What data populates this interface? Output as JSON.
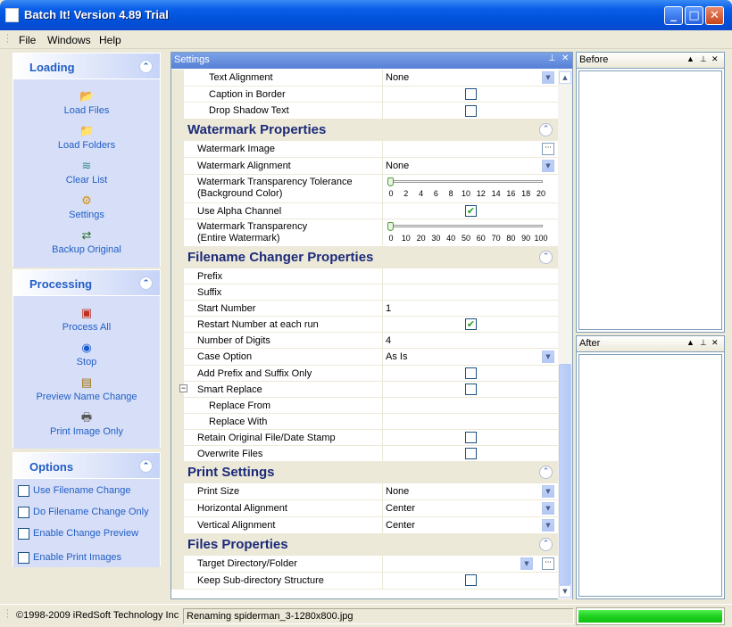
{
  "window": {
    "title": "Batch It! Version 4.89 Trial"
  },
  "menu": {
    "items": [
      "File",
      "Windows",
      "Help"
    ]
  },
  "loading": {
    "title": "Loading",
    "tasks": [
      {
        "label": "Load Files",
        "icon": "folder-open-icon"
      },
      {
        "label": "Load Folders",
        "icon": "folders-icon"
      },
      {
        "label": "Clear List",
        "icon": "clear-list-icon"
      },
      {
        "label": "Settings",
        "icon": "settings-icon"
      },
      {
        "label": "Backup Original",
        "icon": "backup-icon"
      }
    ]
  },
  "processing": {
    "title": "Processing",
    "tasks": [
      {
        "label": "Process All",
        "icon": "process-all-icon"
      },
      {
        "label": "Stop",
        "icon": "stop-icon"
      },
      {
        "label": "Preview Name Change",
        "icon": "preview-icon"
      },
      {
        "label": "Print Image Only",
        "icon": "printer-icon"
      }
    ]
  },
  "options": {
    "title": "Options",
    "items": [
      "Use Filename Change",
      "Do Filename Change Only",
      "Enable Change Preview",
      "Enable Print Images"
    ]
  },
  "settings": {
    "title": "Settings",
    "text_props": [
      {
        "name": "Text Alignment",
        "value": "None"
      },
      {
        "name": "Caption in Border",
        "checked": false
      },
      {
        "name": "Drop Shadow Text",
        "checked": false
      }
    ],
    "watermark": {
      "title": "Watermark Properties",
      "image": "Watermark Image",
      "alignment": {
        "name": "Watermark Alignment",
        "value": "None"
      },
      "tolerance": {
        "name1": "Watermark Transparency Tolerance",
        "name2": "(Background Color)",
        "value": 0,
        "ticks": [
          "0",
          "2",
          "4",
          "6",
          "8",
          "10",
          "12",
          "14",
          "16",
          "18",
          "20"
        ]
      },
      "alpha": {
        "name": "Use Alpha Channel",
        "checked": true
      },
      "transparency": {
        "name1": "Watermark Transparency",
        "name2": "(Entire Watermark)",
        "value": 0,
        "ticks": [
          "0",
          "10",
          "20",
          "30",
          "40",
          "50",
          "60",
          "70",
          "80",
          "90",
          "100"
        ]
      }
    },
    "filename": {
      "title": "Filename Changer Properties",
      "prefix": "Prefix",
      "suffix": "Suffix",
      "start_number": {
        "name": "Start Number",
        "value": "1"
      },
      "restart": {
        "name": "Restart Number at each run",
        "checked": true
      },
      "digits": {
        "name": "Number of Digits",
        "value": "4"
      },
      "case": {
        "name": "Case Option",
        "value": "As Is"
      },
      "add_prefix_suffix": {
        "name": "Add Prefix and Suffix Only",
        "checked": false
      },
      "smart_replace": {
        "name": "Smart Replace",
        "checked": false,
        "expander": "−"
      },
      "replace_from": "Replace From",
      "replace_with": "Replace With",
      "retain_stamp": {
        "name": "Retain Original File/Date Stamp",
        "checked": false
      },
      "overwrite": {
        "name": "Overwrite Files",
        "checked": false
      }
    },
    "print": {
      "title": "Print Settings",
      "size": {
        "name": "Print Size",
        "value": "None"
      },
      "halign": {
        "name": "Horizontal Alignment",
        "value": "Center"
      },
      "valign": {
        "name": "Vertical Alignment",
        "value": "Center"
      }
    },
    "files": {
      "title": "Files Properties",
      "target": {
        "name": "Target Directory/Folder",
        "value": ""
      },
      "keep_sub": {
        "name": "Keep Sub-directory Structure",
        "checked": false
      }
    }
  },
  "before": {
    "title": "Before"
  },
  "after": {
    "title": "After"
  },
  "status": {
    "copyright": "©1998-2009 iRedSoft Technology Inc",
    "message": "Renaming spiderman_3-1280x800.jpg",
    "progress": 1.0
  },
  "colors": {
    "accent": "#215dc6",
    "category_title": "#1c2a7a",
    "progress": "#20d020"
  }
}
